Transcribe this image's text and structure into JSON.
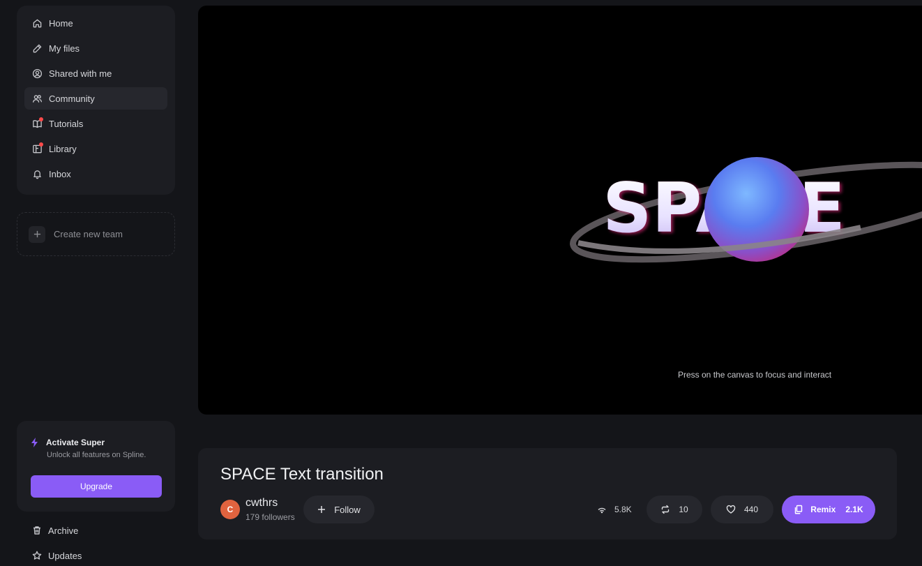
{
  "sidebar": {
    "items": [
      {
        "label": "Home",
        "icon": "home-icon"
      },
      {
        "label": "My files",
        "icon": "pencil-icon"
      },
      {
        "label": "Shared with me",
        "icon": "user-circle-icon"
      },
      {
        "label": "Community",
        "icon": "users-icon",
        "active": true
      },
      {
        "label": "Tutorials",
        "icon": "book-icon",
        "notification": true
      },
      {
        "label": "Library",
        "icon": "library-icon",
        "notification": true
      },
      {
        "label": "Inbox",
        "icon": "bell-icon"
      }
    ],
    "create_team_label": "Create new team",
    "promo": {
      "title": "Activate Super",
      "subtitle": "Unlock all features on Spline.",
      "button_label": "Upgrade"
    },
    "bottom_items": [
      {
        "label": "Archive",
        "icon": "trash-icon"
      },
      {
        "label": "Updates",
        "icon": "star-icon"
      }
    ]
  },
  "canvas": {
    "scene_text": "SPACE",
    "hint": "Press on the canvas to focus and interact"
  },
  "project": {
    "title": "SPACE Text transition",
    "author": {
      "initial": "C",
      "name": "cwthrs",
      "followers": "179 followers"
    },
    "follow_label": "Follow",
    "views": "5.8K",
    "remixes_count": "10",
    "likes": "440",
    "remix_label": "Remix",
    "remix_count": "2.1K"
  },
  "colors": {
    "accent": "#8a5cf6",
    "background": "#141519",
    "card": "#1c1d22",
    "notification": "#ff4a4a",
    "avatar": "#e0633f"
  }
}
